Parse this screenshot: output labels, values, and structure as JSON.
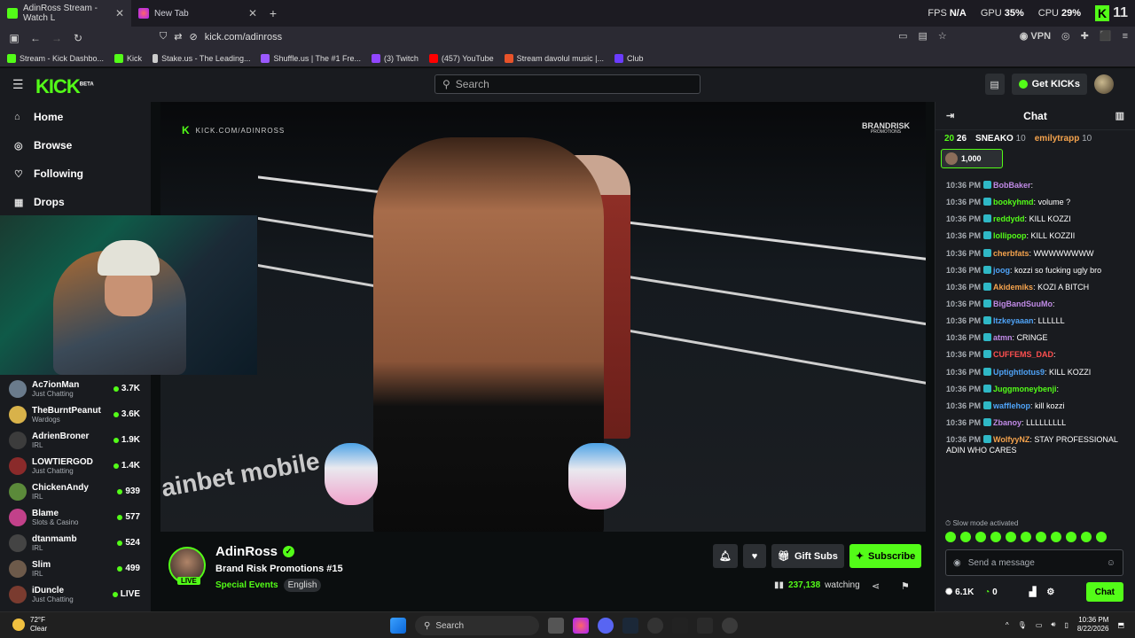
{
  "browser": {
    "tabs": [
      {
        "title": "AdinRoss Stream - Watch L",
        "active": true
      },
      {
        "title": "New Tab",
        "active": false
      }
    ],
    "url": "kick.com/adinross",
    "overlay": {
      "fps_label": "FPS",
      "fps_value": "N/A",
      "gpu_label": "GPU",
      "gpu_value": "35%",
      "cpu_label": "CPU",
      "cpu_value": "29%",
      "k_value": "11"
    },
    "vpn_label": "VPN",
    "bookmarks": [
      "Stream - Kick Dashbo...",
      "Kick",
      "Stake.us - The Leading...",
      "Shuffle.us | The #1 Fre...",
      "(3) Twitch",
      "(457) YouTube",
      "Stream davolul music |...",
      "Club"
    ]
  },
  "header": {
    "logo": "KICK",
    "logo_beta": "BETA",
    "search_placeholder": "Search",
    "get_kicks": "Get KICKs"
  },
  "sidebar": {
    "nav": [
      {
        "label": "Home",
        "icon": "home-icon"
      },
      {
        "label": "Browse",
        "icon": "compass-icon"
      },
      {
        "label": "Following",
        "icon": "heart-icon"
      },
      {
        "label": "Drops",
        "icon": "drops-icon"
      }
    ],
    "recommended": [
      {
        "name": "Ac7ionMan",
        "category": "Just Chatting",
        "viewers": "3.7K",
        "color": "#6a7b8c"
      },
      {
        "name": "TheBurntPeanut",
        "category": "Wardogs",
        "viewers": "3.6K",
        "color": "#d8b24a"
      },
      {
        "name": "AdrienBroner",
        "category": "IRL",
        "viewers": "1.9K",
        "color": "#3c3c3c"
      },
      {
        "name": "LOWTIERGOD",
        "category": "Just Chatting",
        "viewers": "1.4K",
        "color": "#8a2a2a"
      },
      {
        "name": "ChickenAndy",
        "category": "IRL",
        "viewers": "939",
        "color": "#5b8a3a"
      },
      {
        "name": "Blame",
        "category": "Slots & Casino",
        "viewers": "577",
        "color": "#c2418a"
      },
      {
        "name": "dtanmamb",
        "category": "IRL",
        "viewers": "524",
        "color": "#444"
      },
      {
        "name": "Slim",
        "category": "IRL",
        "viewers": "499",
        "color": "#6d5a4a"
      },
      {
        "name": "iDuncle",
        "category": "Just Chatting",
        "viewers": "LIVE",
        "color": "#7a3b2f"
      }
    ]
  },
  "video": {
    "watermark": "KICK.COM/ADINROSS",
    "brand": "BRANDRISK",
    "brand_sub": "PROMOTIONS",
    "ad_text": "ainbet mobile"
  },
  "stream": {
    "streamer": "AdinRoss",
    "live_badge": "LIVE",
    "title": "Brand Risk Promotions #15",
    "category": "Special Events",
    "tag": "English",
    "watching_count": "237,138",
    "watching_label": "watching",
    "gift_subs": "Gift Subs",
    "subscribe": "Subscribe"
  },
  "chat": {
    "title": "Chat",
    "gifters": [
      {
        "name": "20",
        "count": "26"
      },
      {
        "name": "SNEAKO",
        "count": "10"
      },
      {
        "name": "emilytrapp",
        "count": "10"
      }
    ],
    "pinned_amount": "1,000",
    "messages": [
      {
        "time": "10:36 PM",
        "user": "BobBaker",
        "text": "",
        "color": "#c08ae6"
      },
      {
        "time": "10:36 PM",
        "user": "bookyhmd",
        "text": "volume ?",
        "color": "#53fc18"
      },
      {
        "time": "10:36 PM",
        "user": "reddydd",
        "text": "KILL KOZZI",
        "color": "#53fc18"
      },
      {
        "time": "10:36 PM",
        "user": "lollipoop",
        "text": "KILL KOZZII",
        "color": "#53fc18"
      },
      {
        "time": "10:36 PM",
        "user": "cherbfats",
        "text": "WWWWWWWW",
        "color": "#f5a34d"
      },
      {
        "time": "10:36 PM",
        "user": "joog",
        "text": "kozzi so fucking ugly bro",
        "color": "#4fa3f7"
      },
      {
        "time": "10:36 PM",
        "user": "Akidemiks",
        "text": "KOZI A BITCH",
        "color": "#f5a34d"
      },
      {
        "time": "10:36 PM",
        "user": "BigBandSuuMo",
        "text": "",
        "color": "#c08ae6"
      },
      {
        "time": "10:36 PM",
        "user": "Itzkeyaaan",
        "text": "LLLLLL",
        "color": "#4fa3f7"
      },
      {
        "time": "10:36 PM",
        "user": "atmn",
        "text": "CRINGE",
        "color": "#c08ae6"
      },
      {
        "time": "10:36 PM",
        "user": "CUFFEMS_DAD",
        "text": "",
        "color": "#ff4f4f"
      },
      {
        "time": "10:36 PM",
        "user": "Uptightlotus9",
        "text": "KILL KOZZI",
        "color": "#4fa3f7"
      },
      {
        "time": "10:36 PM",
        "user": "Juggmoneybenji",
        "text": "",
        "color": "#53fc18"
      },
      {
        "time": "10:36 PM",
        "user": "wafflehop",
        "text": "kill kozzi",
        "color": "#4fa3f7"
      },
      {
        "time": "10:36 PM",
        "user": "Zbanoy",
        "text": "LLLLLLLLL",
        "color": "#c08ae6"
      },
      {
        "time": "10:36 PM",
        "user": "WolfyyNZ",
        "text": "STAY PROFESSIONAL ADIN WHO CARES",
        "color": "#f5a34d"
      }
    ],
    "slow_mode": "Slow mode activated",
    "placeholder": "Send a message",
    "kicks": "6.1K",
    "points": "0",
    "chat_button": "Chat"
  },
  "taskbar": {
    "temp": "72°F",
    "weather": "Clear",
    "search": "Search",
    "time": "10:36 PM",
    "date": "8/22/2026"
  }
}
